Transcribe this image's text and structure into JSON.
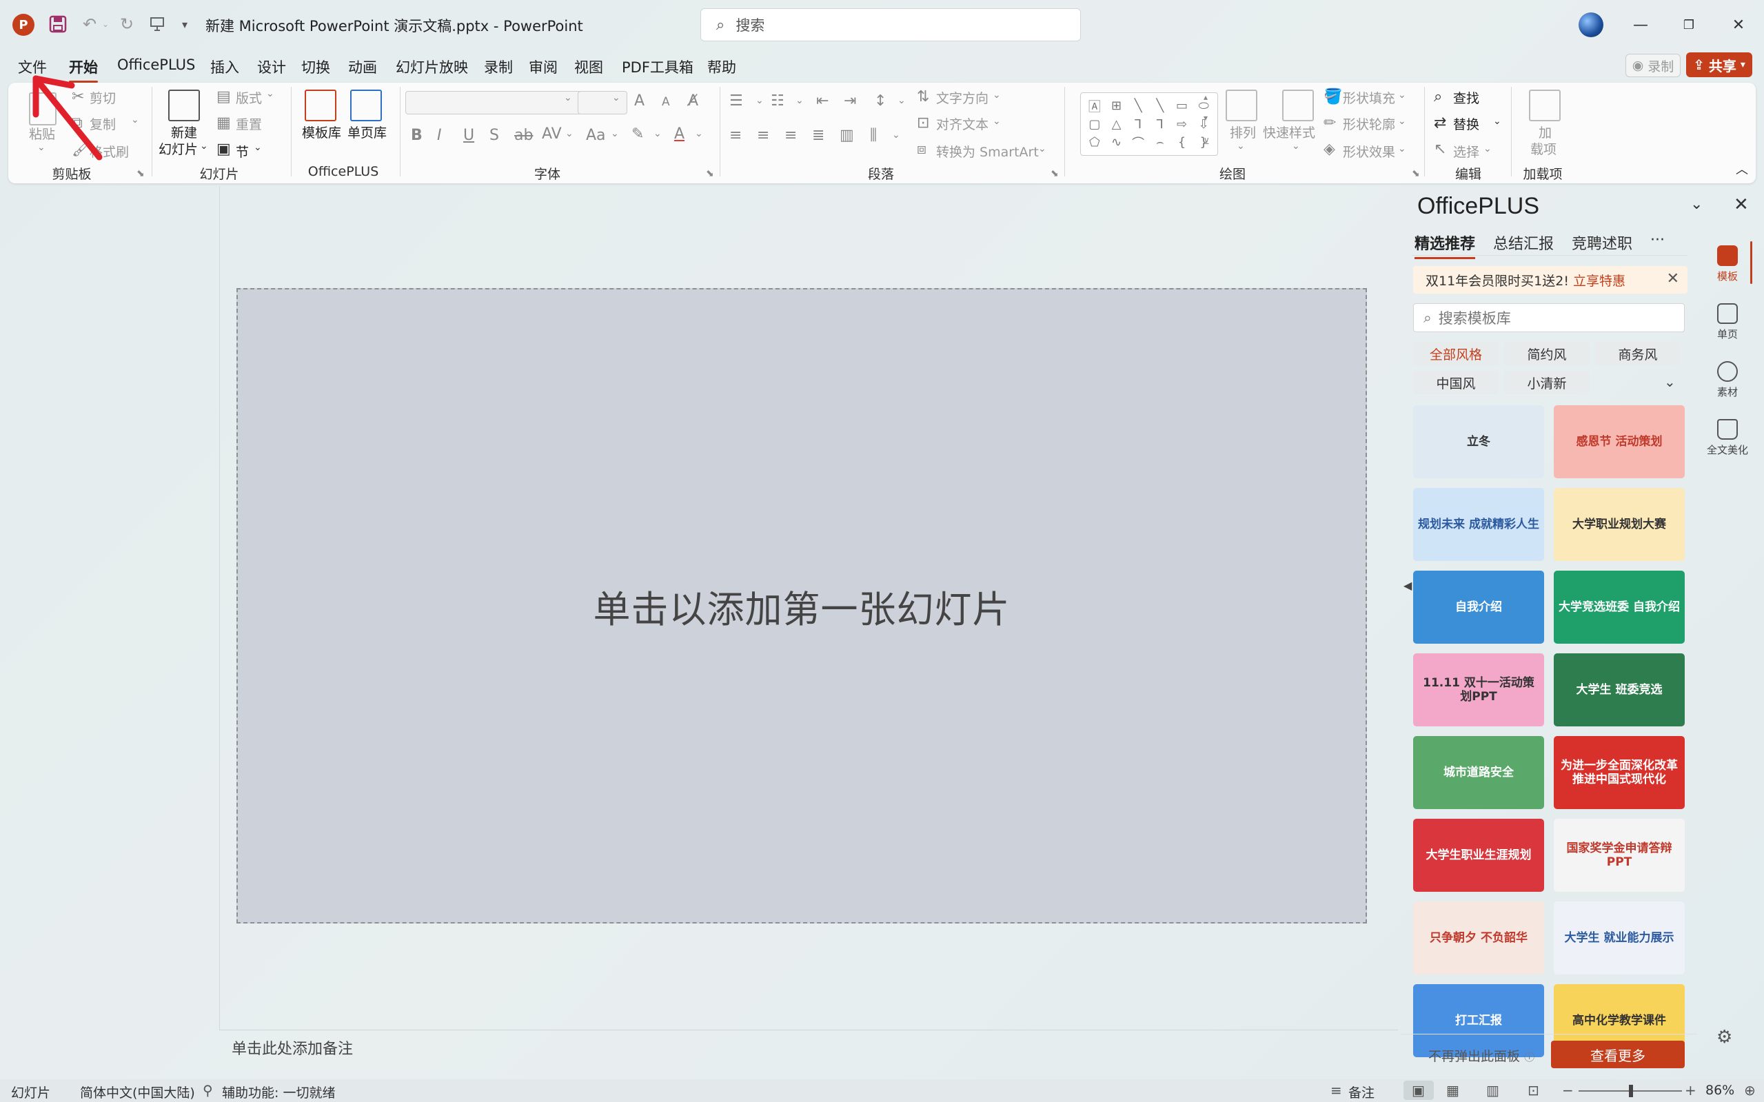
{
  "titlebar": {
    "app_logo": "P",
    "document_title": "新建 Microsoft PowerPoint 演示文稿.pptx  -  PowerPoint",
    "search_placeholder": "搜索",
    "icons": [
      "save-icon",
      "undo-icon",
      "redo-icon",
      "presenter-icon",
      "customize-qat-icon"
    ]
  },
  "menu": {
    "items": [
      "文件",
      "开始",
      "OfficePLUS",
      "插入",
      "设计",
      "切换",
      "动画",
      "幻灯片放映",
      "录制",
      "审阅",
      "视图",
      "PDF工具箱",
      "帮助"
    ],
    "active": "开始",
    "record_label": "录制",
    "share_label": "共享"
  },
  "ribbon": {
    "clipboard": {
      "label": "剪贴板",
      "paste": "粘贴",
      "cut": "剪切",
      "copy": "复制",
      "format_painter": "格式刷"
    },
    "slides": {
      "label": "幻灯片",
      "new_slide_line1": "新建",
      "new_slide_line2": "幻灯片",
      "layout": "版式",
      "reset": "重置",
      "section": "节"
    },
    "officeplus": {
      "label": "OfficePLUS",
      "template_lib": "模板库",
      "page_lib": "单页库"
    },
    "font": {
      "label": "字体",
      "bold": "B",
      "italic": "I",
      "underline": "U",
      "shadow": "S",
      "strike": "ab",
      "spacing": "AV",
      "case": "Aa",
      "color": "A",
      "grow": "A",
      "shrink": "A"
    },
    "paragraph": {
      "label": "段落",
      "text_direction": "文字方向",
      "align_text": "对齐文本",
      "smartart": "转换为 SmartArt"
    },
    "drawing": {
      "label": "绘图",
      "arrange": "排列",
      "quick_styles": "快速样式",
      "shape_fill": "形状填充",
      "shape_outline": "形状轮廓",
      "shape_effects": "形状效果"
    },
    "editing": {
      "label": "编辑",
      "find": "查找",
      "replace": "替换",
      "select": "选择"
    },
    "addins": {
      "label": "加载项",
      "btn_line1": "加",
      "btn_line2": "载项"
    }
  },
  "slide": {
    "placeholder": "单击以添加第一张幻灯片",
    "notes_placeholder": "单击此处添加备注"
  },
  "taskpane": {
    "title": "OfficePLUS",
    "tabs": [
      "精选推荐",
      "总结汇报",
      "竞聘述职",
      "···"
    ],
    "active_tab": "精选推荐",
    "banner_text": "双11年会员限时买1送2!",
    "banner_link": "立享特惠",
    "search_placeholder": "搜索模板库",
    "chips": [
      "全部风格",
      "简约风",
      "商务风",
      "中国风",
      "小清新"
    ],
    "active_chip": "全部风格",
    "templates": [
      {
        "text": "立冬",
        "bg": "#dfe9f1",
        "fg": "#333"
      },
      {
        "text": "感恩节 活动策划",
        "bg": "#f6b8b0",
        "fg": "#c0392b"
      },
      {
        "text": "规划未来 成就精彩人生",
        "bg": "#cfe4f7",
        "fg": "#2c5aa0"
      },
      {
        "text": "大学职业规划大赛",
        "bg": "#fbe9b9",
        "fg": "#333"
      },
      {
        "text": "自我介绍",
        "bg": "#3b8fd6",
        "fg": "#ffffff"
      },
      {
        "text": "大学竞选班委 自我介绍",
        "bg": "#1fa06a",
        "fg": "#ffffff"
      },
      {
        "text": "11.11 双十一活动策划PPT",
        "bg": "#f3a7c9",
        "fg": "#333"
      },
      {
        "text": "大学生 班委竞选",
        "bg": "#2e7d4f",
        "fg": "#ffffff"
      },
      {
        "text": "城市道路安全",
        "bg": "#5aa96b",
        "fg": "#ffffff"
      },
      {
        "text": "为进一步全面深化改革推进中国式现代化",
        "bg": "#d8302a",
        "fg": "#ffffff"
      },
      {
        "text": "大学生职业生涯规划",
        "bg": "#d9363e",
        "fg": "#ffffff"
      },
      {
        "text": "国家奖学金申请答辩PPT",
        "bg": "#f4f4f4",
        "fg": "#c0392b"
      },
      {
        "text": "只争朝夕 不负韶华",
        "bg": "#f6e7e1",
        "fg": "#c0392b"
      },
      {
        "text": "大学生 就业能力展示",
        "bg": "#eef1f7",
        "fg": "#2c5aa0"
      },
      {
        "text": "打工汇报",
        "bg": "#4a90e2",
        "fg": "#ffffff"
      },
      {
        "text": "高中化学教学课件",
        "bg": "#f7d35a",
        "fg": "#333"
      }
    ],
    "no_show_label": "不再弹出此面板",
    "more_label": "查看更多"
  },
  "rail": {
    "items": [
      "模板",
      "单页",
      "素材",
      "全文美化"
    ],
    "active": "模板"
  },
  "statusbar": {
    "slide_label": "幻灯片",
    "language": "简体中文(中国大陆)",
    "accessibility": "辅助功能: 一切就绪",
    "notes_label": "备注",
    "zoom_label": "86%",
    "zoom_value": 86
  },
  "colors": {
    "accent": "#c43e1c",
    "slide_bg": "#cdd1d9",
    "annotation_arrow": "#e0202a"
  }
}
